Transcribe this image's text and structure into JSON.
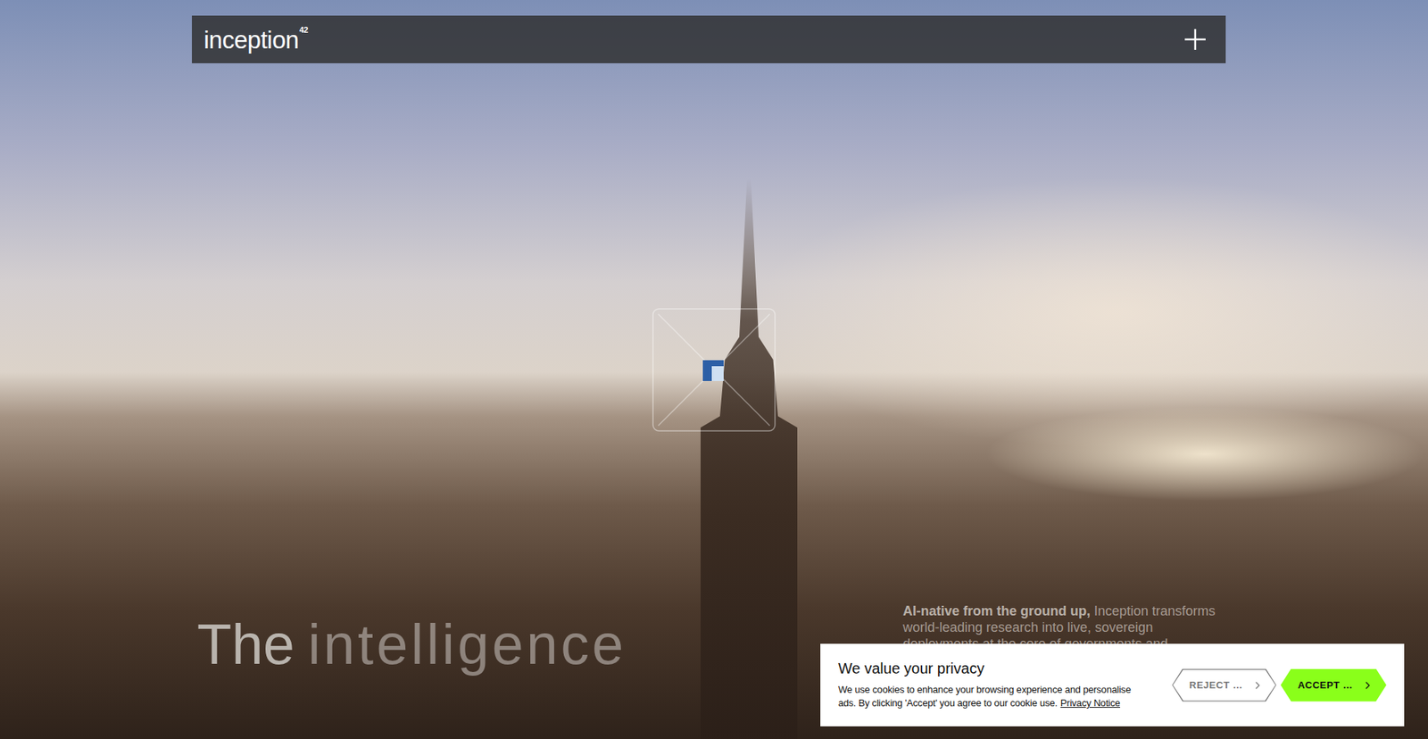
{
  "header": {
    "logo": "inception",
    "logo_superscript": "42"
  },
  "hero": {
    "title_lead": "The",
    "title_rest": "intelligence",
    "intro_lead": "AI-native from the ground up,",
    "intro_rest": "Inception transforms world-leading research into live, sovereign deployments at the core of governments and"
  },
  "cookie_banner": {
    "title": "We value your privacy",
    "body": "We use cookies to enhance your browsing experience and personalise ads. By clicking 'Accept' you agree to our cookie use.",
    "link": "Privacy Notice",
    "buttons": [
      {
        "label": "REJECT …",
        "kind": "outline"
      },
      {
        "label": "ACCEPT …",
        "kind": "primary"
      }
    ]
  }
}
